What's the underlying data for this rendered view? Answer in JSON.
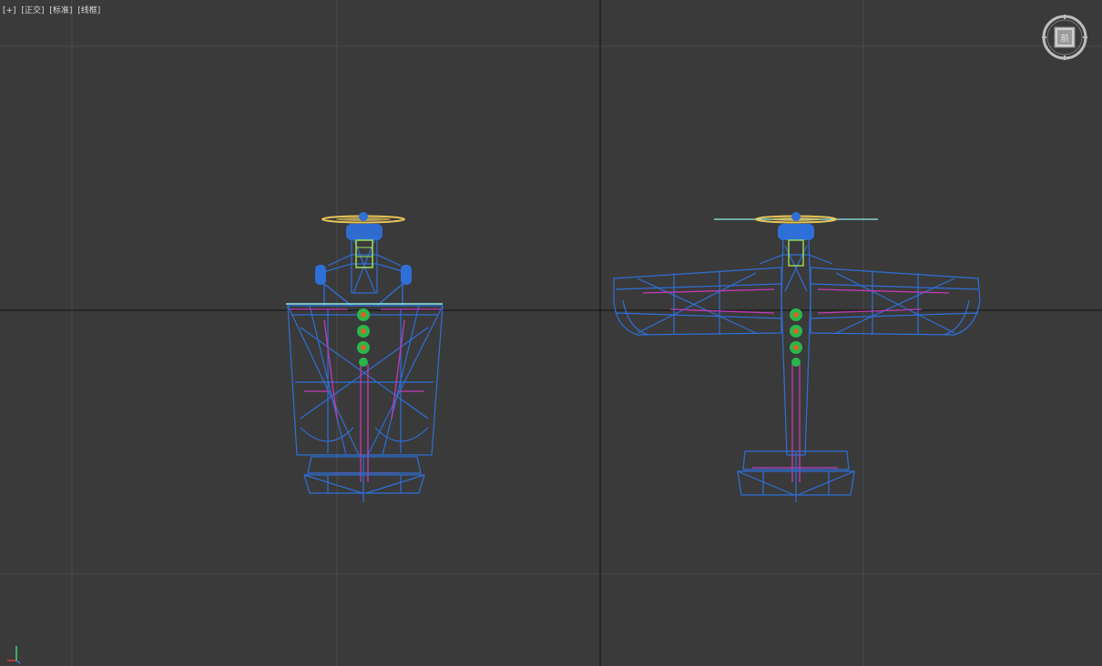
{
  "viewport": {
    "label": {
      "plus": "[+]",
      "view": "[正交]",
      "shading": "[标准]",
      "style": "[线框]"
    },
    "viewcube": {
      "face": "前"
    }
  },
  "colors": {
    "background": "#3a3a3a",
    "grid": "#4a4a4a",
    "axis": "#111111",
    "wire_blue": "#2f6fd8",
    "wire_magenta": "#c23ab8",
    "wire_green": "#28b84a",
    "wire_orange": "#d8642a",
    "propeller_yellow": "#e8c45a",
    "cyan_line": "#8ef0e8"
  },
  "icons": {
    "viewcube": "viewcube-icon",
    "axis": "axis-tripod-icon"
  }
}
